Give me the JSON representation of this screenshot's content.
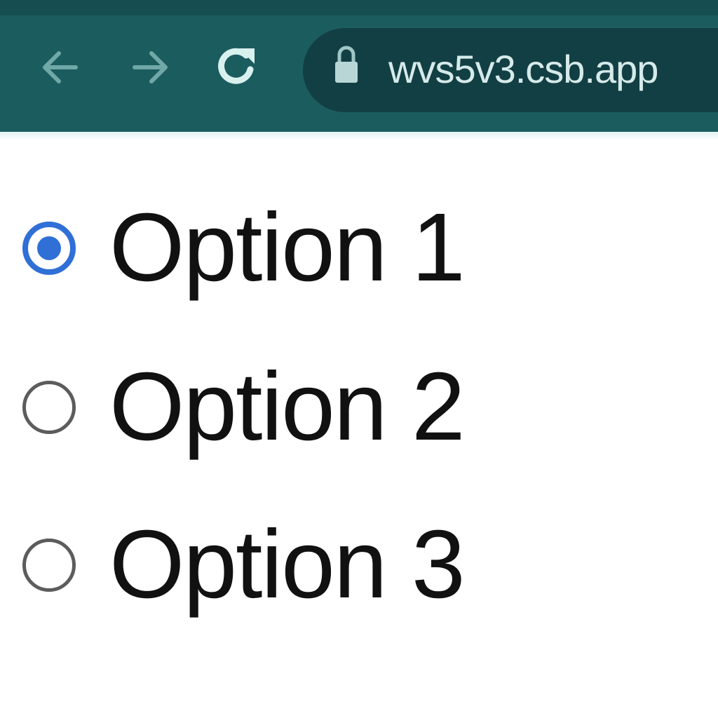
{
  "browser": {
    "url": "wvs5v3.csb.app",
    "icons": {
      "back": "arrow-left-icon",
      "forward": "arrow-right-icon",
      "reload": "reload-icon",
      "lock": "lock-icon"
    },
    "colors": {
      "toolbar": "#1b5c5f",
      "address_bar": "#123f44",
      "icon": "#7fb8b6",
      "url_text": "#d6eaea"
    }
  },
  "radio_group": {
    "selected_index": 0,
    "options": [
      {
        "label": "Option 1",
        "checked": true
      },
      {
        "label": "Option 2",
        "checked": false
      },
      {
        "label": "Option 3",
        "checked": false
      }
    ],
    "colors": {
      "checked": "#2f6fd6",
      "unchecked_border": "#5c5c5c",
      "label": "#111111"
    }
  }
}
